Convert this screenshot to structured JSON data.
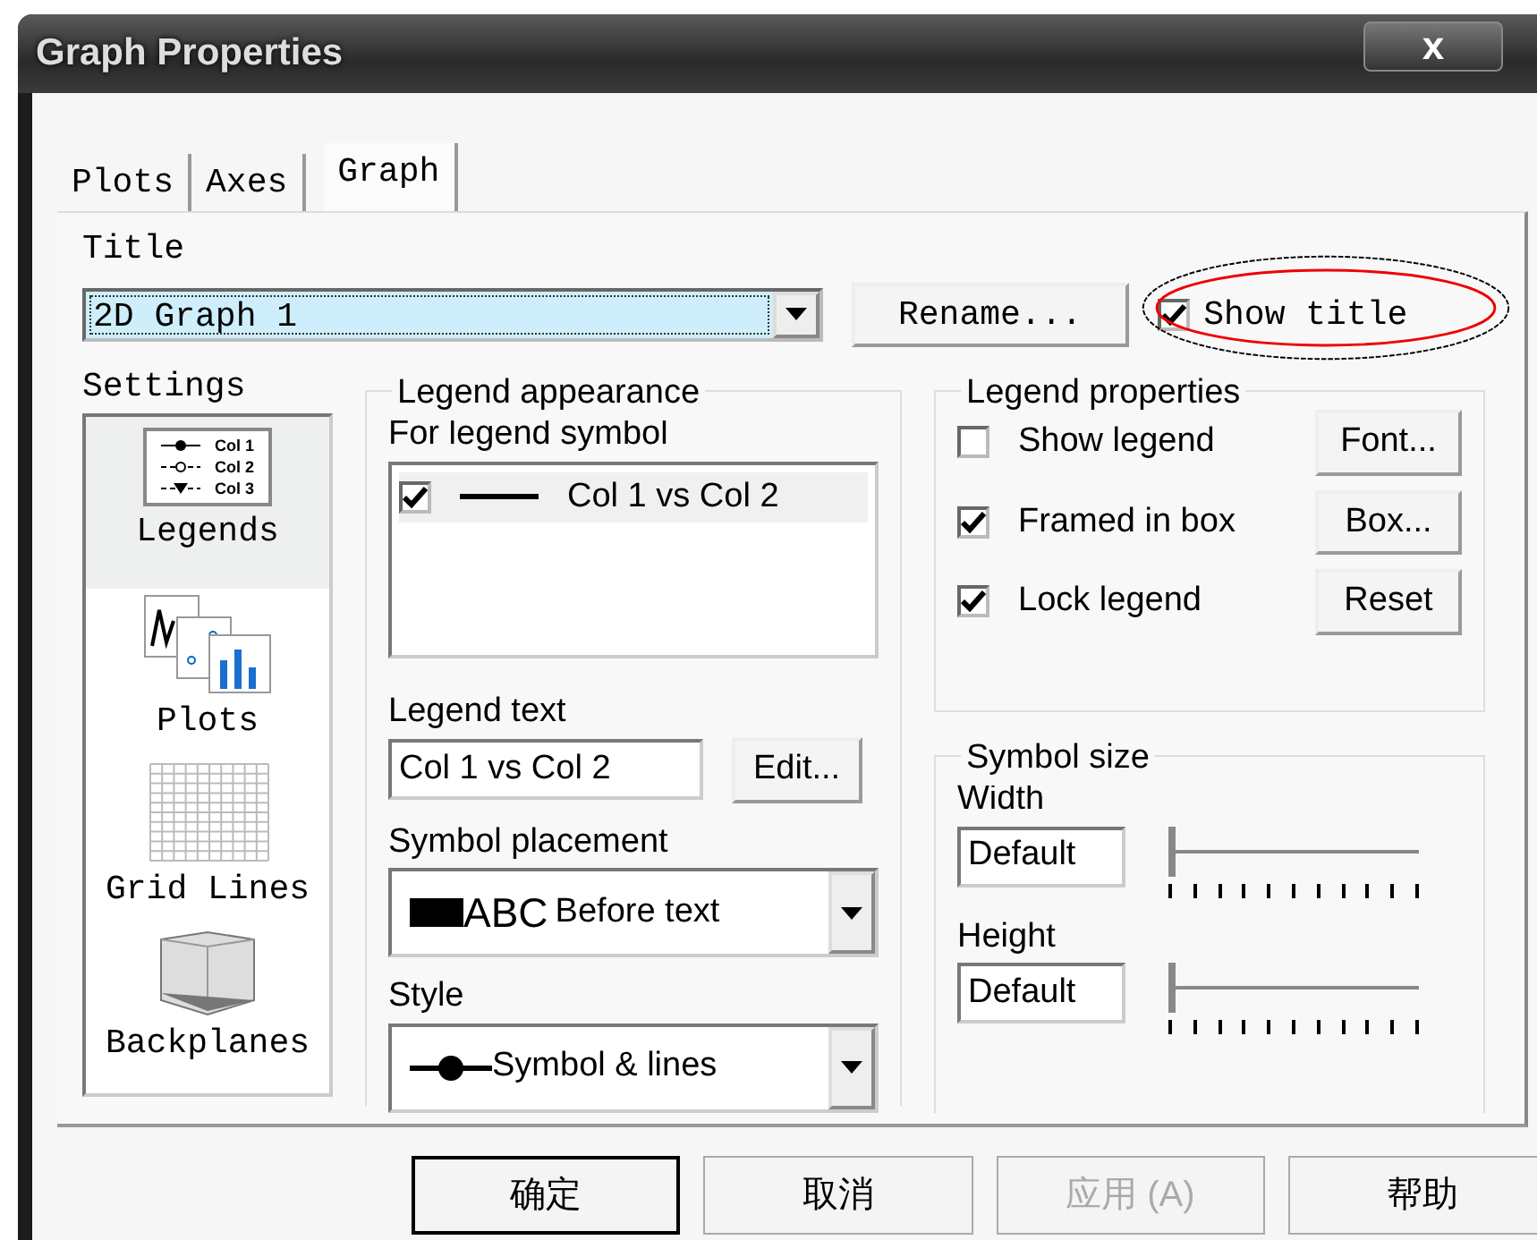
{
  "window": {
    "title": "Graph Properties",
    "close_label": "x"
  },
  "tabs": [
    {
      "label": "Plots",
      "selected": false
    },
    {
      "label": "Axes",
      "selected": false
    },
    {
      "label": "Graph",
      "selected": true
    }
  ],
  "title_section": {
    "label": "Title",
    "value": "2D Graph 1",
    "rename_button": "Rename...",
    "show_title": {
      "label": "Show title",
      "checked": true,
      "circled": true
    }
  },
  "settings": {
    "label": "Settings",
    "items": [
      {
        "label": "Legends",
        "kind": "legends",
        "selected": true,
        "icon_texts": [
          "Col 1",
          "Col 2",
          "Col 3"
        ]
      },
      {
        "label": "Plots",
        "kind": "plots",
        "selected": false
      },
      {
        "label": "Grid Lines",
        "kind": "grid",
        "selected": false
      },
      {
        "label": "Backplanes",
        "kind": "backplanes",
        "selected": false
      }
    ]
  },
  "legend_appearance": {
    "title": "Legend appearance",
    "symbol_label": "For legend symbol",
    "symbols": [
      {
        "text": "Col 1 vs Col 2",
        "checked": true
      }
    ],
    "legend_text_label": "Legend text",
    "legend_text_value": "Col 1 vs Col 2",
    "edit_button": "Edit...",
    "placement_label": "Symbol placement",
    "placement": {
      "sample": "ABC",
      "text": "Before text"
    },
    "style_label": "Style",
    "style_value": "Symbol & lines"
  },
  "legend_properties": {
    "title": "Legend properties",
    "options": [
      {
        "label": "Show legend",
        "checked": false,
        "button": "Font..."
      },
      {
        "label": "Framed in box",
        "checked": true,
        "button": "Box..."
      },
      {
        "label": "Lock legend",
        "checked": true,
        "button": "Reset"
      }
    ]
  },
  "symbol_size": {
    "title": "Symbol size",
    "rows": [
      {
        "label": "Width",
        "value": "Default",
        "level": 0
      },
      {
        "label": "Height",
        "value": "Default",
        "level": 0
      }
    ]
  },
  "buttons": [
    {
      "label": "确定",
      "default": true,
      "disabled": false
    },
    {
      "label": "取消",
      "default": false,
      "disabled": false
    },
    {
      "label": "应用 (A)",
      "default": false,
      "disabled": true
    },
    {
      "label": "帮助",
      "default": false,
      "disabled": false
    }
  ]
}
